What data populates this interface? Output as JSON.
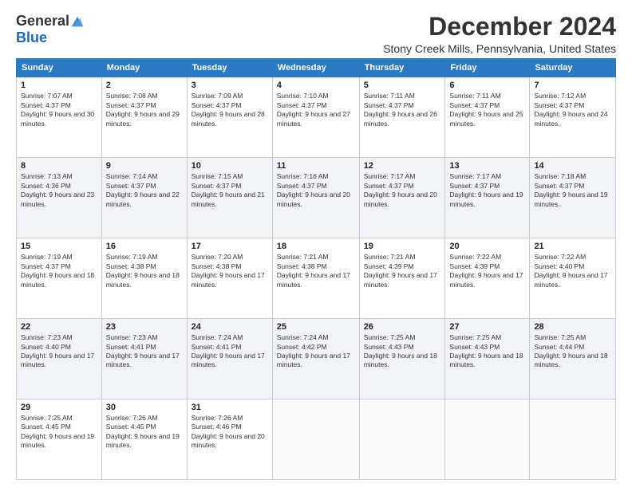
{
  "logo": {
    "general": "General",
    "blue": "Blue"
  },
  "title": "December 2024",
  "location": "Stony Creek Mills, Pennsylvania, United States",
  "days_of_week": [
    "Sunday",
    "Monday",
    "Tuesday",
    "Wednesday",
    "Thursday",
    "Friday",
    "Saturday"
  ],
  "weeks": [
    [
      {
        "day": "1",
        "sunrise": "Sunrise: 7:07 AM",
        "sunset": "Sunset: 4:37 PM",
        "daylight": "Daylight: 9 hours and 30 minutes."
      },
      {
        "day": "2",
        "sunrise": "Sunrise: 7:08 AM",
        "sunset": "Sunset: 4:37 PM",
        "daylight": "Daylight: 9 hours and 29 minutes."
      },
      {
        "day": "3",
        "sunrise": "Sunrise: 7:09 AM",
        "sunset": "Sunset: 4:37 PM",
        "daylight": "Daylight: 9 hours and 28 minutes."
      },
      {
        "day": "4",
        "sunrise": "Sunrise: 7:10 AM",
        "sunset": "Sunset: 4:37 PM",
        "daylight": "Daylight: 9 hours and 27 minutes."
      },
      {
        "day": "5",
        "sunrise": "Sunrise: 7:11 AM",
        "sunset": "Sunset: 4:37 PM",
        "daylight": "Daylight: 9 hours and 26 minutes."
      },
      {
        "day": "6",
        "sunrise": "Sunrise: 7:11 AM",
        "sunset": "Sunset: 4:37 PM",
        "daylight": "Daylight: 9 hours and 25 minutes."
      },
      {
        "day": "7",
        "sunrise": "Sunrise: 7:12 AM",
        "sunset": "Sunset: 4:37 PM",
        "daylight": "Daylight: 9 hours and 24 minutes."
      }
    ],
    [
      {
        "day": "8",
        "sunrise": "Sunrise: 7:13 AM",
        "sunset": "Sunset: 4:36 PM",
        "daylight": "Daylight: 9 hours and 23 minutes."
      },
      {
        "day": "9",
        "sunrise": "Sunrise: 7:14 AM",
        "sunset": "Sunset: 4:37 PM",
        "daylight": "Daylight: 9 hours and 22 minutes."
      },
      {
        "day": "10",
        "sunrise": "Sunrise: 7:15 AM",
        "sunset": "Sunset: 4:37 PM",
        "daylight": "Daylight: 9 hours and 21 minutes."
      },
      {
        "day": "11",
        "sunrise": "Sunrise: 7:16 AM",
        "sunset": "Sunset: 4:37 PM",
        "daylight": "Daylight: 9 hours and 20 minutes."
      },
      {
        "day": "12",
        "sunrise": "Sunrise: 7:17 AM",
        "sunset": "Sunset: 4:37 PM",
        "daylight": "Daylight: 9 hours and 20 minutes."
      },
      {
        "day": "13",
        "sunrise": "Sunrise: 7:17 AM",
        "sunset": "Sunset: 4:37 PM",
        "daylight": "Daylight: 9 hours and 19 minutes."
      },
      {
        "day": "14",
        "sunrise": "Sunrise: 7:18 AM",
        "sunset": "Sunset: 4:37 PM",
        "daylight": "Daylight: 9 hours and 19 minutes."
      }
    ],
    [
      {
        "day": "15",
        "sunrise": "Sunrise: 7:19 AM",
        "sunset": "Sunset: 4:37 PM",
        "daylight": "Daylight: 9 hours and 18 minutes."
      },
      {
        "day": "16",
        "sunrise": "Sunrise: 7:19 AM",
        "sunset": "Sunset: 4:38 PM",
        "daylight": "Daylight: 9 hours and 18 minutes."
      },
      {
        "day": "17",
        "sunrise": "Sunrise: 7:20 AM",
        "sunset": "Sunset: 4:38 PM",
        "daylight": "Daylight: 9 hours and 17 minutes."
      },
      {
        "day": "18",
        "sunrise": "Sunrise: 7:21 AM",
        "sunset": "Sunset: 4:38 PM",
        "daylight": "Daylight: 9 hours and 17 minutes."
      },
      {
        "day": "19",
        "sunrise": "Sunrise: 7:21 AM",
        "sunset": "Sunset: 4:39 PM",
        "daylight": "Daylight: 9 hours and 17 minutes."
      },
      {
        "day": "20",
        "sunrise": "Sunrise: 7:22 AM",
        "sunset": "Sunset: 4:39 PM",
        "daylight": "Daylight: 9 hours and 17 minutes."
      },
      {
        "day": "21",
        "sunrise": "Sunrise: 7:22 AM",
        "sunset": "Sunset: 4:40 PM",
        "daylight": "Daylight: 9 hours and 17 minutes."
      }
    ],
    [
      {
        "day": "22",
        "sunrise": "Sunrise: 7:23 AM",
        "sunset": "Sunset: 4:40 PM",
        "daylight": "Daylight: 9 hours and 17 minutes."
      },
      {
        "day": "23",
        "sunrise": "Sunrise: 7:23 AM",
        "sunset": "Sunset: 4:41 PM",
        "daylight": "Daylight: 9 hours and 17 minutes."
      },
      {
        "day": "24",
        "sunrise": "Sunrise: 7:24 AM",
        "sunset": "Sunset: 4:41 PM",
        "daylight": "Daylight: 9 hours and 17 minutes."
      },
      {
        "day": "25",
        "sunrise": "Sunrise: 7:24 AM",
        "sunset": "Sunset: 4:42 PM",
        "daylight": "Daylight: 9 hours and 17 minutes."
      },
      {
        "day": "26",
        "sunrise": "Sunrise: 7:25 AM",
        "sunset": "Sunset: 4:43 PM",
        "daylight": "Daylight: 9 hours and 18 minutes."
      },
      {
        "day": "27",
        "sunrise": "Sunrise: 7:25 AM",
        "sunset": "Sunset: 4:43 PM",
        "daylight": "Daylight: 9 hours and 18 minutes."
      },
      {
        "day": "28",
        "sunrise": "Sunrise: 7:25 AM",
        "sunset": "Sunset: 4:44 PM",
        "daylight": "Daylight: 9 hours and 18 minutes."
      }
    ],
    [
      {
        "day": "29",
        "sunrise": "Sunrise: 7:25 AM",
        "sunset": "Sunset: 4:45 PM",
        "daylight": "Daylight: 9 hours and 19 minutes."
      },
      {
        "day": "30",
        "sunrise": "Sunrise: 7:26 AM",
        "sunset": "Sunset: 4:45 PM",
        "daylight": "Daylight: 9 hours and 19 minutes."
      },
      {
        "day": "31",
        "sunrise": "Sunrise: 7:26 AM",
        "sunset": "Sunset: 4:46 PM",
        "daylight": "Daylight: 9 hours and 20 minutes."
      },
      null,
      null,
      null,
      null
    ]
  ]
}
